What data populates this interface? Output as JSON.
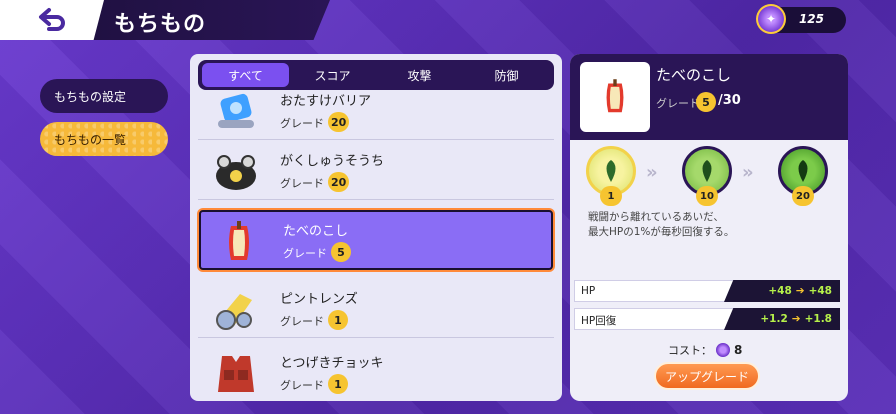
{
  "header": {
    "title": "もちもの",
    "back_icon": "back-arrow-icon",
    "currency_value": "125",
    "currency_icon": "item-ticket-icon"
  },
  "sidebar": {
    "items": [
      {
        "label": "もちもの設定"
      },
      {
        "label": "もちもの一覧"
      }
    ]
  },
  "tabs": [
    {
      "label": "すべて"
    },
    {
      "label": "スコア"
    },
    {
      "label": "攻撃"
    },
    {
      "label": "防御"
    }
  ],
  "items": [
    {
      "name": "おたすけバリア",
      "grade_label": "グレード",
      "grade": "20"
    },
    {
      "name": "がくしゅうそうち",
      "grade_label": "グレード",
      "grade": "20"
    },
    {
      "name": "たべのこし",
      "grade_label": "グレード",
      "grade": "5"
    },
    {
      "name": "ピントレンズ",
      "grade_label": "グレード",
      "grade": "1"
    },
    {
      "name": "とつげきチョッキ",
      "grade_label": "グレード",
      "grade": "1"
    }
  ],
  "detail": {
    "name": "たべのこし",
    "grade_label": "グレード",
    "grade": "5",
    "grade_max": "/30",
    "stages": [
      "1",
      "10",
      "20"
    ],
    "description_line1": "戦闘から離れているあいだ、",
    "description_line2": "最大HPの1%が毎秒回復する。",
    "stats": [
      {
        "label": "HP",
        "from": "+48",
        "to": "+48"
      },
      {
        "label": "HP回復",
        "from": "+1.2",
        "to": "+1.8"
      }
    ],
    "cost_label": "コスト：",
    "cost_value": "8",
    "upgrade_label": "アップグレード"
  },
  "colors": {
    "accent": "#7b50f0",
    "gold": "#f6c430",
    "orange": "#f06a20",
    "dark": "#2a1556"
  }
}
